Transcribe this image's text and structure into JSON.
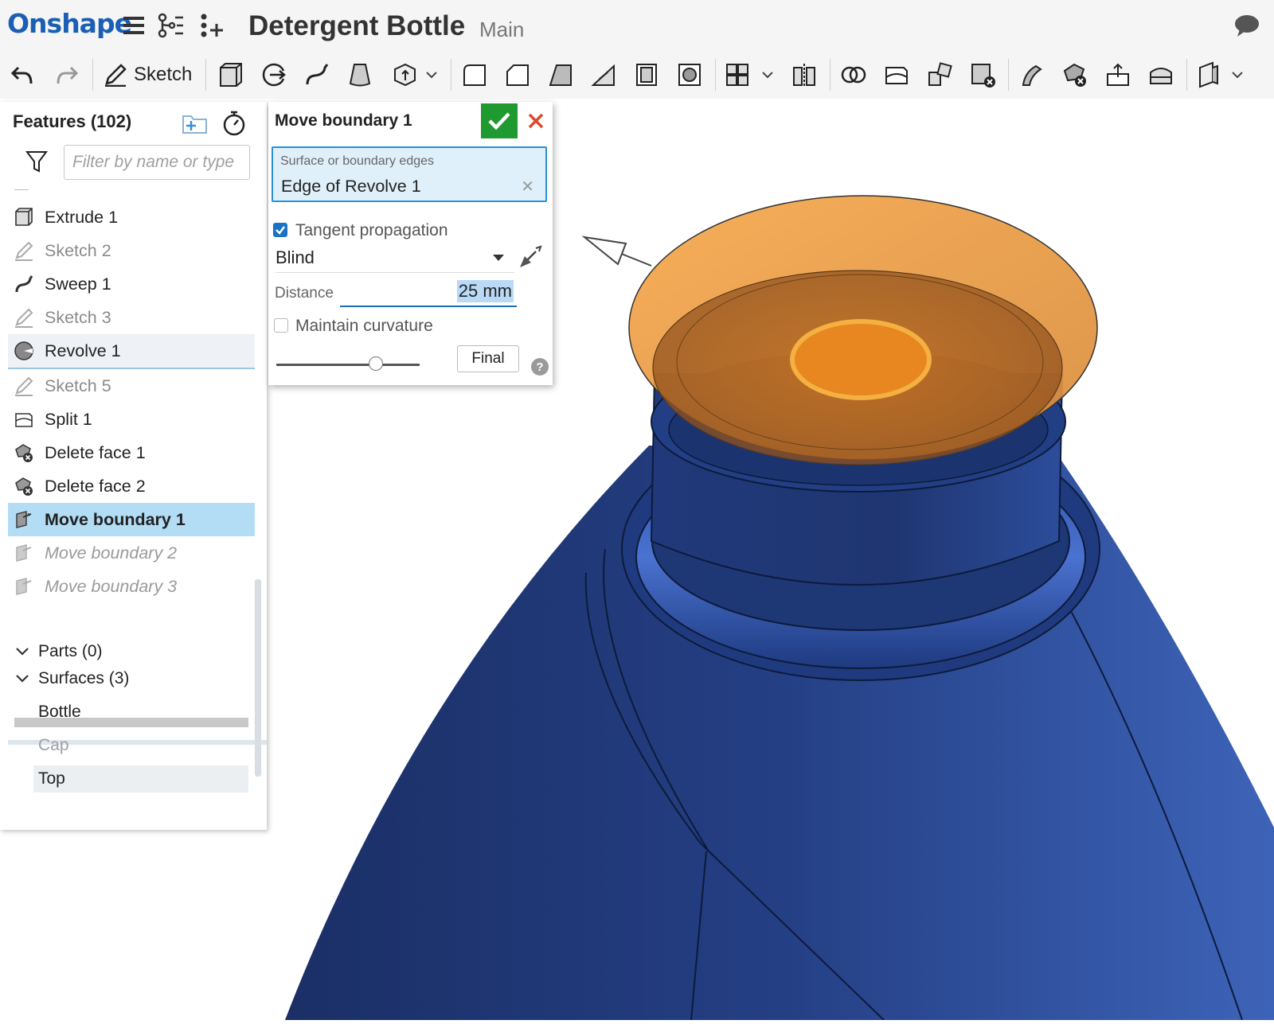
{
  "header": {
    "logo": "Onshape",
    "document_title": "Detergent Bottle",
    "branch": "Main",
    "icons": [
      "menu-icon",
      "feature-tree-icon",
      "add-variable-icon",
      "comments-icon"
    ]
  },
  "toolbar": {
    "sketch_label": "Sketch",
    "tools": [
      "undo-icon",
      "redo-icon",
      "extrude-icon",
      "revolve-icon",
      "sweep-icon",
      "loft-icon",
      "thicken-icon",
      "fillet-icon",
      "chamfer-icon",
      "draft-icon",
      "rib-icon",
      "shell-icon",
      "hole-icon",
      "pattern-icon",
      "mirror-icon",
      "boolean-icon",
      "split-icon",
      "transform-icon",
      "delete-part-icon",
      "move-face-icon",
      "delete-face-icon",
      "extend-icon",
      "enclose-icon",
      "plane-icon"
    ]
  },
  "features": {
    "title": "Features (102)",
    "filter_placeholder": "Filter by name or type",
    "items": [
      {
        "label": "Extrude 1",
        "icon": "extrude-icon",
        "state": "normal"
      },
      {
        "label": "Sketch 2",
        "icon": "sketch-icon",
        "state": "dim"
      },
      {
        "label": "Sweep 1",
        "icon": "sweep-icon",
        "state": "normal"
      },
      {
        "label": "Sketch 3",
        "icon": "sketch-icon",
        "state": "dim"
      },
      {
        "label": "Revolve 1",
        "icon": "revolve-icon",
        "state": "hover"
      },
      {
        "label": "Sketch 5",
        "icon": "sketch-icon",
        "state": "dim"
      },
      {
        "label": "Split 1",
        "icon": "split-icon",
        "state": "normal"
      },
      {
        "label": "Delete face 1",
        "icon": "delete-face-icon",
        "state": "normal"
      },
      {
        "label": "Delete face 2",
        "icon": "delete-face-icon",
        "state": "normal"
      },
      {
        "label": "Move boundary 1",
        "icon": "move-boundary-icon",
        "state": "selected"
      },
      {
        "label": "Move boundary 2",
        "icon": "move-boundary-icon",
        "state": "rolledback"
      },
      {
        "label": "Move boundary 3",
        "icon": "move-boundary-icon",
        "state": "rolledback"
      }
    ]
  },
  "parts": {
    "parts_label": "Parts (0)",
    "surfaces_label": "Surfaces (3)",
    "surfaces": [
      {
        "label": "Bottle",
        "state": "normal"
      },
      {
        "label": "Cap",
        "state": "dim"
      },
      {
        "label": "Top",
        "state": "highlight"
      }
    ]
  },
  "dialog": {
    "title": "Move boundary 1",
    "selection_label": "Surface or boundary edges",
    "selection_value": "Edge of Revolve 1",
    "tangent_propagation_label": "Tangent propagation",
    "tangent_propagation_checked": true,
    "end_type": "Blind",
    "distance_label": "Distance",
    "distance_value": "25 mm",
    "maintain_curvature_label": "Maintain curvature",
    "maintain_curvature_checked": false,
    "final_label": "Final",
    "help": "?"
  },
  "colors": {
    "brand": "#1a5fb4",
    "accept": "#1e9a30",
    "cancel": "#d9492e",
    "selection": "#b3dcf5",
    "model": "#1f3a7a",
    "preview": "#f0a04a"
  }
}
